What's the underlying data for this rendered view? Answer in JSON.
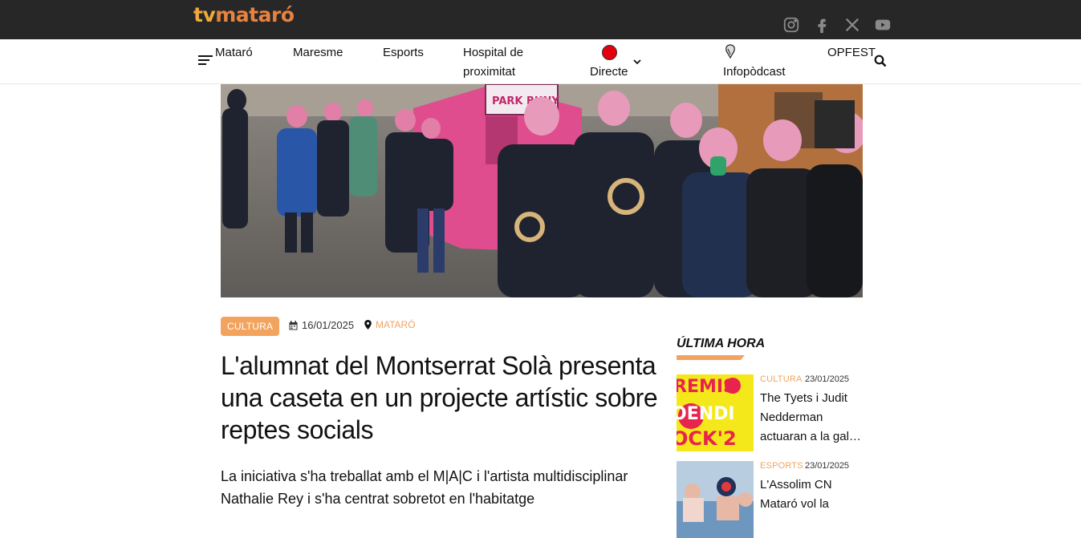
{
  "brand": {
    "logo_part1": "tv",
    "logo_part2": "mataró"
  },
  "social": [
    "instagram-icon",
    "facebook-icon",
    "x-icon",
    "youtube-icon"
  ],
  "nav": {
    "items": [
      {
        "label": "Mataró"
      },
      {
        "label": "Maresme"
      },
      {
        "label": "Esports"
      },
      {
        "label": "Hospital de proximitat"
      },
      {
        "label": "Directe"
      },
      {
        "label": "Infopòdcast"
      },
      {
        "label": "OPFEST"
      }
    ]
  },
  "article": {
    "category": "CULTURA",
    "date": "16/01/2025",
    "place": "MATARÓ",
    "headline": "L'alumnat del Montserrat Solà presenta una caseta en un projecte artístic sobre reptes socials",
    "lead": "La iniciativa s'ha treballat amb el M|A|C i l'artista multidisciplinar Nathalie Rey i s'ha centrat sobretot en l'habitatge",
    "hero_sign": "PARK BUNY"
  },
  "sidebar": {
    "title": "ÚLTIMA HORA",
    "items": [
      {
        "category": "CULTURA",
        "date": "23/01/2025",
        "title": "The Tyets i Judit Nedderman actuaran a la gal…",
        "thumb_text": "REMIS ENDI OCK'2"
      },
      {
        "category": "ESPORTS",
        "date": "23/01/2025",
        "title": "L'Assolim CN Mataró vol la"
      }
    ]
  },
  "colors": {
    "accent": "#f2a45e",
    "topbar": "#272727",
    "live": "#e3000f"
  }
}
